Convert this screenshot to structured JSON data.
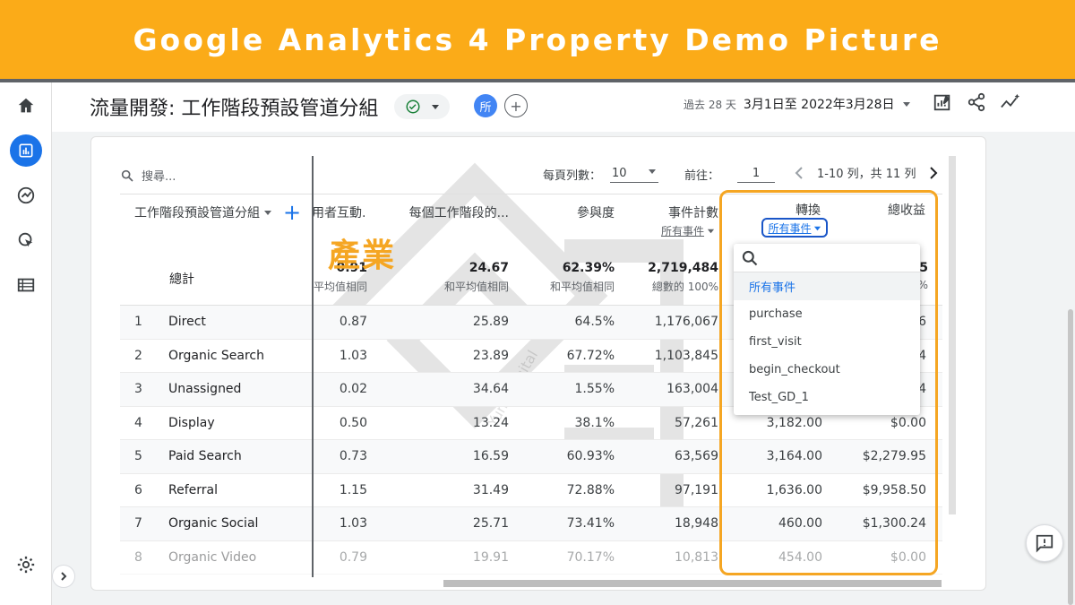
{
  "banner": {
    "title": "Google Analytics 4 Property Demo Picture"
  },
  "header": {
    "title": "流量開發: 工作階段預設管道分組",
    "comparison_badge": "所",
    "date_label": "過去 28 天",
    "date_value": "3月1日至 2022年3月28日"
  },
  "toolbar": {
    "search_placeholder": "搜尋...",
    "rows_per_page_label": "每頁列數：",
    "rows_per_page_value": "10",
    "goto_label": "前往：",
    "goto_value": "1",
    "range_text": "1-10 列，共 11 列"
  },
  "columns": {
    "dimension": "工作階段預設管道分組",
    "engaged_sessions": "用者互動...",
    "per_session": "每個工作階段的...",
    "engagement_rate": "參與度",
    "event_count": "事件計數",
    "event_count_filter": "所有事件",
    "conversions": "轉換",
    "conversions_filter": "所有事件",
    "revenue": "總收益"
  },
  "totals": {
    "label": "總計",
    "engaged_sessions": "0.91",
    "engaged_sessions_sub": "平均值相同",
    "per_session": "24.67",
    "per_session_sub": "和平均值相同",
    "engagement_rate": "62.39%",
    "engagement_rate_sub": "和平均值相同",
    "event_count": "2,719,484",
    "event_count_sub": "總數的 100%",
    "revenue_partial": "5",
    "revenue_sub_partial": "%"
  },
  "rows": [
    {
      "idx": "1",
      "name": "Direct",
      "c1": "0.87",
      "c2": "25.89",
      "c3": "64.5%",
      "c4": "1,176,067",
      "conv": "",
      "rev": "6"
    },
    {
      "idx": "2",
      "name": "Organic Search",
      "c1": "1.03",
      "c2": "23.89",
      "c3": "67.72%",
      "c4": "1,103,845",
      "conv": "",
      "rev": "4"
    },
    {
      "idx": "3",
      "name": "Unassigned",
      "c1": "0.02",
      "c2": "34.64",
      "c3": "1.55%",
      "c4": "163,004",
      "conv": "",
      "rev": "4"
    },
    {
      "idx": "4",
      "name": "Display",
      "c1": "0.50",
      "c2": "13.24",
      "c3": "38.1%",
      "c4": "57,261",
      "conv": "3,182.00",
      "rev": "$0.00"
    },
    {
      "idx": "5",
      "name": "Paid Search",
      "c1": "0.73",
      "c2": "16.59",
      "c3": "60.93%",
      "c4": "63,569",
      "conv": "3,164.00",
      "rev": "$2,279.95"
    },
    {
      "idx": "6",
      "name": "Referral",
      "c1": "1.15",
      "c2": "31.49",
      "c3": "72.88%",
      "c4": "97,191",
      "conv": "1,636.00",
      "rev": "$9,958.50"
    },
    {
      "idx": "7",
      "name": "Organic Social",
      "c1": "1.03",
      "c2": "25.71",
      "c3": "73.41%",
      "c4": "18,948",
      "conv": "460.00",
      "rev": "$1,300.24"
    },
    {
      "idx": "8",
      "name": "Organic Video",
      "c1": "0.79",
      "c2": "19.91",
      "c3": "70.17%",
      "c4": "10,813",
      "conv": "454.00",
      "rev": "$0.00"
    }
  ],
  "dropdown": {
    "items": [
      "所有事件",
      "purchase",
      "first_visit",
      "begin_checkout",
      "Test_GD_1"
    ]
  },
  "overlay_word": "產業",
  "watermark_text": "Yung Digital",
  "colors": {
    "banner": "#fbab18",
    "accent": "#1a73e8",
    "highlight": "#f5a623"
  }
}
